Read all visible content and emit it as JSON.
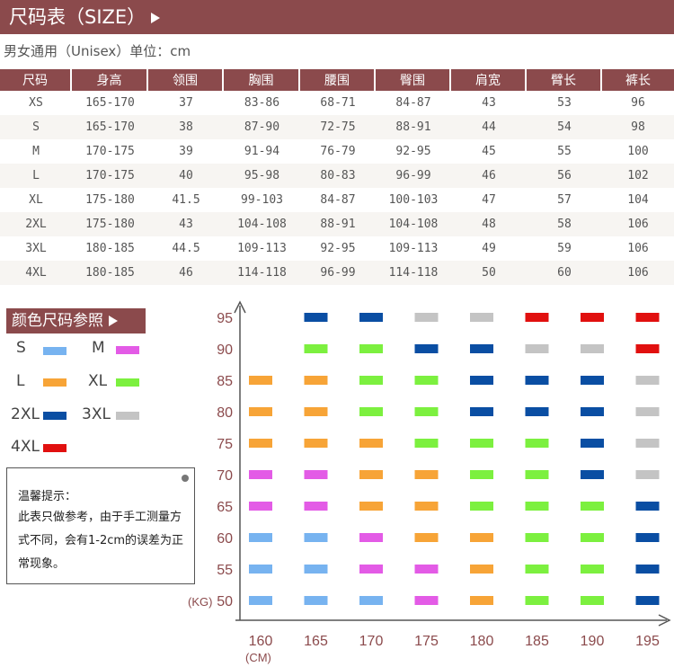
{
  "header": {
    "title": "尺码表（SIZE）"
  },
  "subtitle": "男女通用（Unisex）单位：cm",
  "table": {
    "headers": [
      "尺码",
      "身高",
      "领围",
      "胸围",
      "腰围",
      "臀围",
      "肩宽",
      "臂长",
      "裤长"
    ],
    "rows": [
      [
        "XS",
        "165-170",
        "37",
        "83-86",
        "68-71",
        "84-87",
        "43",
        "53",
        "96"
      ],
      [
        "S",
        "165-170",
        "38",
        "87-90",
        "72-75",
        "88-91",
        "44",
        "54",
        "98"
      ],
      [
        "M",
        "170-175",
        "39",
        "91-94",
        "76-79",
        "92-95",
        "45",
        "55",
        "100"
      ],
      [
        "L",
        "170-175",
        "40",
        "95-98",
        "80-83",
        "96-99",
        "46",
        "56",
        "102"
      ],
      [
        "XL",
        "175-180",
        "41.5",
        "99-103",
        "84-87",
        "100-103",
        "47",
        "57",
        "104"
      ],
      [
        "2XL",
        "175-180",
        "43",
        "104-108",
        "88-91",
        "104-108",
        "48",
        "58",
        "106"
      ],
      [
        "3XL",
        "180-185",
        "44.5",
        "109-113",
        "92-95",
        "109-113",
        "49",
        "59",
        "106"
      ],
      [
        "4XL",
        "180-185",
        "46",
        "114-118",
        "96-99",
        "114-118",
        "50",
        "60",
        "106"
      ]
    ]
  },
  "legend": {
    "title": "颜色尺码参照",
    "items": [
      {
        "size": "S",
        "color": "#77b3f0"
      },
      {
        "size": "M",
        "color": "#e35be6"
      },
      {
        "size": "L",
        "color": "#f7a437"
      },
      {
        "size": "XL",
        "color": "#7cf03f"
      },
      {
        "size": "2XL",
        "color": "#0a4ea3"
      },
      {
        "size": "3XL",
        "color": "#c4c4c4"
      },
      {
        "size": "4XL",
        "color": "#e1100f"
      }
    ]
  },
  "tip": {
    "title": "温馨提示：",
    "body": "此表只做参考，由于手工测量方式不同，会有1-2cm的误差为正常现象。"
  },
  "chart_data": {
    "type": "heatmap",
    "x": [
      160,
      165,
      170,
      175,
      180,
      185,
      190,
      195
    ],
    "y": [
      50,
      55,
      60,
      65,
      70,
      75,
      80,
      85,
      90,
      95
    ],
    "xlabel": "(CM)",
    "ylabel": "(KG)",
    "cells": [
      [
        "S",
        "S",
        "S",
        "M",
        "L",
        "XL",
        "XL",
        "2XL"
      ],
      [
        "S",
        "S",
        "M",
        "M",
        "L",
        "XL",
        "XL",
        "2XL"
      ],
      [
        "S",
        "S",
        "M",
        "L",
        "L",
        "XL",
        "XL",
        "2XL"
      ],
      [
        "M",
        "M",
        "L",
        "L",
        "XL",
        "XL",
        "XL",
        "2XL"
      ],
      [
        "M",
        "M",
        "L",
        "L",
        "XL",
        "XL",
        "2XL",
        "3XL"
      ],
      [
        "L",
        "L",
        "L",
        "XL",
        "XL",
        "XL",
        "2XL",
        "3XL"
      ],
      [
        "L",
        "L",
        "XL",
        "XL",
        "2XL",
        "2XL",
        "2XL",
        "3XL"
      ],
      [
        "L",
        "L",
        "XL",
        "XL",
        "2XL",
        "2XL",
        "2XL",
        "3XL"
      ],
      [
        null,
        "XL",
        "XL",
        "2XL",
        "2XL",
        "3XL",
        "3XL",
        "4XL"
      ],
      [
        null,
        "2XL",
        "2XL",
        "3XL",
        "3XL",
        "4XL",
        "4XL",
        "4XL"
      ]
    ]
  }
}
